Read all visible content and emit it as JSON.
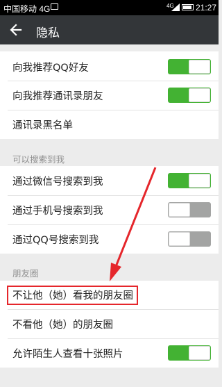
{
  "status_bar": {
    "carrier": "中国移动 4G",
    "signal": "4G",
    "time": "21:27"
  },
  "app_bar": {
    "title": "隐私",
    "back_icon": "arrow-left-icon"
  },
  "rows_top": [
    {
      "label": "向我推荐QQ好友",
      "switch": "on"
    },
    {
      "label": "向我推荐通讯录朋友",
      "switch": "on"
    },
    {
      "label": "通讯录黑名单"
    }
  ],
  "group_search": {
    "header": "可以搜索到我",
    "rows": [
      {
        "label": "通过微信号搜索到我",
        "switch": "on"
      },
      {
        "label": "通过手机号搜索到我",
        "switch": "off"
      },
      {
        "label": "通过QQ号搜索到我",
        "switch": "off"
      }
    ]
  },
  "group_moments": {
    "header": "朋友圈",
    "rows": [
      {
        "label": "不让他（她）看我的朋友圈"
      },
      {
        "label": "不看他（她）的朋友圈"
      },
      {
        "label": "允许陌生人查看十张照片",
        "switch": "on"
      }
    ]
  },
  "colors": {
    "switch_on": "#43b233",
    "switch_off": "#a3a4a3",
    "highlight": "#e5262b",
    "app_bar": "#333639"
  }
}
